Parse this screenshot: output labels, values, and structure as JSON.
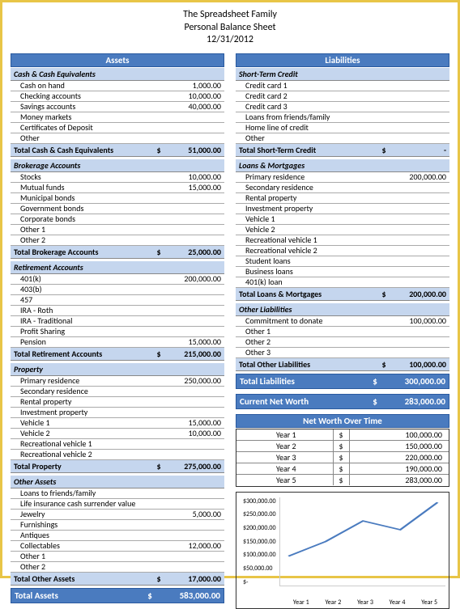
{
  "header": {
    "line1": "The Spreadsheet Family",
    "line2": "Personal Balance Sheet",
    "line3": "12/31/2012"
  },
  "assets": {
    "title": "Assets",
    "cash": {
      "header": "Cash & Cash Equivalents",
      "rows": [
        {
          "label": "Cash on hand",
          "val": "1,000.00"
        },
        {
          "label": "Checking accounts",
          "val": "10,000.00"
        },
        {
          "label": "Savings accounts",
          "val": "40,000.00"
        },
        {
          "label": "Money markets",
          "val": ""
        },
        {
          "label": "Certificates of Deposit",
          "val": ""
        },
        {
          "label": "Other",
          "val": ""
        }
      ],
      "total_label": "Total Cash & Cash Equivalents",
      "total_val": "51,000.00"
    },
    "brokerage": {
      "header": "Brokerage Accounts",
      "rows": [
        {
          "label": "Stocks",
          "val": "10,000.00"
        },
        {
          "label": "Mutual funds",
          "val": "15,000.00"
        },
        {
          "label": "Municipal bonds",
          "val": ""
        },
        {
          "label": "Government bonds",
          "val": ""
        },
        {
          "label": "Corporate bonds",
          "val": ""
        },
        {
          "label": "Other 1",
          "val": ""
        },
        {
          "label": "Other 2",
          "val": ""
        }
      ],
      "total_label": "Total Brokerage Accounts",
      "total_val": "25,000.00"
    },
    "retirement": {
      "header": "Retirement Accounts",
      "rows": [
        {
          "label": "401(k)",
          "val": "200,000.00"
        },
        {
          "label": "403(b)",
          "val": ""
        },
        {
          "label": "457",
          "val": ""
        },
        {
          "label": "IRA - Roth",
          "val": ""
        },
        {
          "label": "IRA - Traditional",
          "val": ""
        },
        {
          "label": "Profit Sharing",
          "val": ""
        },
        {
          "label": "Pension",
          "val": "15,000.00"
        }
      ],
      "total_label": "Total Retirement Accounts",
      "total_val": "215,000.00"
    },
    "property": {
      "header": "Property",
      "rows": [
        {
          "label": "Primary residence",
          "val": "250,000.00"
        },
        {
          "label": "Secondary residence",
          "val": ""
        },
        {
          "label": "Rental property",
          "val": ""
        },
        {
          "label": "Investment property",
          "val": ""
        },
        {
          "label": "Vehicle 1",
          "val": "15,000.00"
        },
        {
          "label": "Vehicle 2",
          "val": "10,000.00"
        },
        {
          "label": "Recreational vehicle 1",
          "val": ""
        },
        {
          "label": "Recreational vehicle 2",
          "val": ""
        }
      ],
      "total_label": "Total Property",
      "total_val": "275,000.00"
    },
    "other": {
      "header": "Other Assets",
      "rows": [
        {
          "label": "Loans to friends/family",
          "val": ""
        },
        {
          "label": "Life insurance cash surrender value",
          "val": ""
        },
        {
          "label": "Jewelry",
          "val": "5,000.00"
        },
        {
          "label": "Furnishings",
          "val": ""
        },
        {
          "label": "Antiques",
          "val": ""
        },
        {
          "label": "Collectables",
          "val": "12,000.00"
        },
        {
          "label": "Other 1",
          "val": ""
        },
        {
          "label": "Other 2",
          "val": ""
        }
      ],
      "total_label": "Total Other Assets",
      "total_val": "17,000.00"
    },
    "grand_label": "Total Assets",
    "grand_val": "583,000.00"
  },
  "liabilities": {
    "title": "Liabilities",
    "short": {
      "header": "Short-Term Credit",
      "rows": [
        {
          "label": "Credit card 1",
          "val": ""
        },
        {
          "label": "Credit card 2",
          "val": ""
        },
        {
          "label": "Credit card 3",
          "val": ""
        },
        {
          "label": "Loans from friends/family",
          "val": ""
        },
        {
          "label": "Home line of credit",
          "val": ""
        },
        {
          "label": "Other",
          "val": ""
        }
      ],
      "total_label": "Total Short-Term Credit",
      "total_val": "-"
    },
    "loans": {
      "header": "Loans & Mortgages",
      "rows": [
        {
          "label": "Primary residence",
          "val": "200,000.00"
        },
        {
          "label": "Secondary residence",
          "val": ""
        },
        {
          "label": "Rental property",
          "val": ""
        },
        {
          "label": "Investment property",
          "val": ""
        },
        {
          "label": "Vehicle 1",
          "val": ""
        },
        {
          "label": "Vehicle 2",
          "val": ""
        },
        {
          "label": "Recreational vehicle 1",
          "val": ""
        },
        {
          "label": "Recreational vehicle 2",
          "val": ""
        },
        {
          "label": "Student loans",
          "val": ""
        },
        {
          "label": "Business loans",
          "val": ""
        },
        {
          "label": "401(k) loan",
          "val": ""
        }
      ],
      "total_label": "Total Loans & Mortgages",
      "total_val": "200,000.00"
    },
    "other": {
      "header": "Other Liabilities",
      "rows": [
        {
          "label": "Commitment to donate",
          "val": "100,000.00"
        },
        {
          "label": "Other 1",
          "val": ""
        },
        {
          "label": "Other 2",
          "val": ""
        },
        {
          "label": "Other 3",
          "val": ""
        }
      ],
      "total_label": "Total Other Liabilities",
      "total_val": "100,000.00"
    },
    "grand_label": "Total Liabilities",
    "grand_val": "300,000.00"
  },
  "networth": {
    "label": "Current Net Worth",
    "val": "283,000.00"
  },
  "networth_table": {
    "title": "Net Worth Over Time",
    "rows": [
      {
        "label": "Year 1",
        "val": "100,000.00"
      },
      {
        "label": "Year 2",
        "val": "150,000.00"
      },
      {
        "label": "Year 3",
        "val": "220,000.00"
      },
      {
        "label": "Year 4",
        "val": "190,000.00"
      },
      {
        "label": "Year 5",
        "val": "283,000.00"
      }
    ]
  },
  "chart_data": {
    "type": "line",
    "categories": [
      "Year 1",
      "Year 2",
      "Year 3",
      "Year 4",
      "Year 5"
    ],
    "values": [
      100000,
      150000,
      220000,
      190000,
      283000
    ],
    "ylim": [
      0,
      300000
    ],
    "yticks": [
      "$-",
      "$50,000.00",
      "$100,000.00",
      "$150,000.00",
      "$200,000.00",
      "$250,000.00",
      "$300,000.00"
    ]
  },
  "currency": "$"
}
